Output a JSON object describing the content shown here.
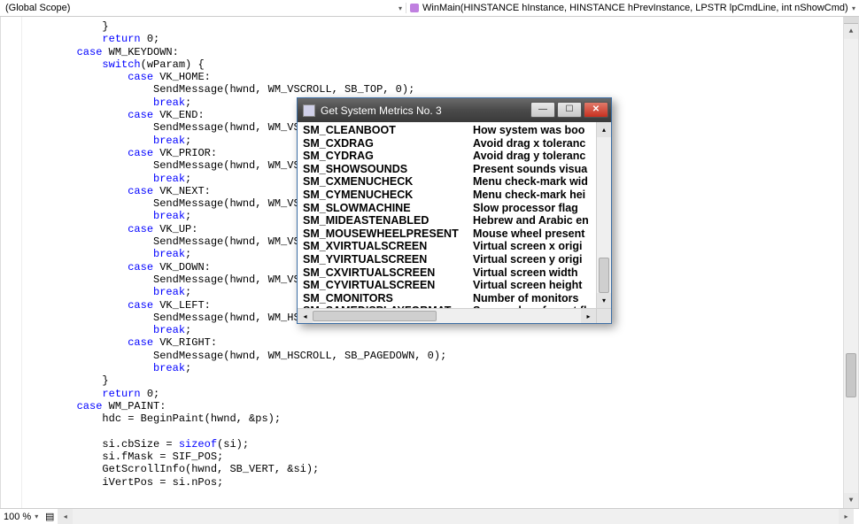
{
  "header": {
    "scope": "(Global Scope)",
    "function": "WinMain(HINSTANCE hInstance, HINSTANCE hPrevInstance, LPSTR lpCmdLine, int nShowCmd)"
  },
  "code": {
    "lines": [
      {
        "indent": 12,
        "tokens": [
          {
            "t": "}",
            "c": ""
          }
        ]
      },
      {
        "indent": 12,
        "tokens": [
          {
            "t": "return",
            "c": "kw"
          },
          {
            "t": " 0;",
            "c": ""
          }
        ]
      },
      {
        "indent": 8,
        "tokens": [
          {
            "t": "case",
            "c": "kw"
          },
          {
            "t": " WM_KEYDOWN:",
            "c": ""
          }
        ]
      },
      {
        "indent": 12,
        "tokens": [
          {
            "t": "switch",
            "c": "kw"
          },
          {
            "t": "(wParam) {",
            "c": ""
          }
        ]
      },
      {
        "indent": 16,
        "tokens": [
          {
            "t": "case",
            "c": "kw"
          },
          {
            "t": " VK_HOME:",
            "c": ""
          }
        ]
      },
      {
        "indent": 20,
        "tokens": [
          {
            "t": "SendMessage(hwnd, WM_VSCROLL, SB_TOP, 0);",
            "c": ""
          }
        ]
      },
      {
        "indent": 20,
        "tokens": [
          {
            "t": "break",
            "c": "kw"
          },
          {
            "t": ";",
            "c": ""
          }
        ]
      },
      {
        "indent": 16,
        "tokens": [
          {
            "t": "case",
            "c": "kw"
          },
          {
            "t": " VK_END:",
            "c": ""
          }
        ]
      },
      {
        "indent": 20,
        "tokens": [
          {
            "t": "SendMessage(hwnd, WM_VSCROLL",
            "c": ""
          }
        ]
      },
      {
        "indent": 20,
        "tokens": [
          {
            "t": "break",
            "c": "kw"
          },
          {
            "t": ";",
            "c": ""
          }
        ]
      },
      {
        "indent": 16,
        "tokens": [
          {
            "t": "case",
            "c": "kw"
          },
          {
            "t": " VK_PRIOR:",
            "c": ""
          }
        ]
      },
      {
        "indent": 20,
        "tokens": [
          {
            "t": "SendMessage(hwnd, WM_VSCROLL",
            "c": ""
          }
        ]
      },
      {
        "indent": 20,
        "tokens": [
          {
            "t": "break",
            "c": "kw"
          },
          {
            "t": ";",
            "c": ""
          }
        ]
      },
      {
        "indent": 16,
        "tokens": [
          {
            "t": "case",
            "c": "kw"
          },
          {
            "t": " VK_NEXT:",
            "c": ""
          }
        ]
      },
      {
        "indent": 20,
        "tokens": [
          {
            "t": "SendMessage(hwnd, WM_VSCROLL",
            "c": ""
          }
        ]
      },
      {
        "indent": 20,
        "tokens": [
          {
            "t": "break",
            "c": "kw"
          },
          {
            "t": ";",
            "c": ""
          }
        ]
      },
      {
        "indent": 16,
        "tokens": [
          {
            "t": "case",
            "c": "kw"
          },
          {
            "t": " VK_UP:",
            "c": ""
          }
        ]
      },
      {
        "indent": 20,
        "tokens": [
          {
            "t": "SendMessage(hwnd, WM_VSCROLL",
            "c": ""
          }
        ]
      },
      {
        "indent": 20,
        "tokens": [
          {
            "t": "break",
            "c": "kw"
          },
          {
            "t": ";",
            "c": ""
          }
        ]
      },
      {
        "indent": 16,
        "tokens": [
          {
            "t": "case",
            "c": "kw"
          },
          {
            "t": " VK_DOWN:",
            "c": ""
          }
        ]
      },
      {
        "indent": 20,
        "tokens": [
          {
            "t": "SendMessage(hwnd, WM_VSCROLL",
            "c": ""
          }
        ]
      },
      {
        "indent": 20,
        "tokens": [
          {
            "t": "break",
            "c": "kw"
          },
          {
            "t": ";",
            "c": ""
          }
        ]
      },
      {
        "indent": 16,
        "tokens": [
          {
            "t": "case",
            "c": "kw"
          },
          {
            "t": " VK_LEFT:",
            "c": ""
          }
        ]
      },
      {
        "indent": 20,
        "tokens": [
          {
            "t": "SendMessage(hwnd, WM_HSCROLL",
            "c": ""
          }
        ]
      },
      {
        "indent": 20,
        "tokens": [
          {
            "t": "break",
            "c": "kw"
          },
          {
            "t": ";",
            "c": ""
          }
        ]
      },
      {
        "indent": 16,
        "tokens": [
          {
            "t": "case",
            "c": "kw"
          },
          {
            "t": " VK_RIGHT:",
            "c": ""
          }
        ]
      },
      {
        "indent": 20,
        "tokens": [
          {
            "t": "SendMessage(hwnd, WM_HSCROLL, SB_PAGEDOWN, 0);",
            "c": ""
          }
        ]
      },
      {
        "indent": 20,
        "tokens": [
          {
            "t": "break",
            "c": "kw"
          },
          {
            "t": ";",
            "c": ""
          }
        ]
      },
      {
        "indent": 12,
        "tokens": [
          {
            "t": "}",
            "c": ""
          }
        ]
      },
      {
        "indent": 12,
        "tokens": [
          {
            "t": "return",
            "c": "kw"
          },
          {
            "t": " 0;",
            "c": ""
          }
        ]
      },
      {
        "indent": 8,
        "tokens": [
          {
            "t": "case",
            "c": "kw"
          },
          {
            "t": " WM_PAINT:",
            "c": ""
          }
        ]
      },
      {
        "indent": 12,
        "tokens": [
          {
            "t": "hdc = BeginPaint(hwnd, &ps);",
            "c": ""
          }
        ]
      },
      {
        "indent": 12,
        "tokens": [
          {
            "t": "",
            "c": ""
          }
        ]
      },
      {
        "indent": 12,
        "tokens": [
          {
            "t": "si.cbSize = ",
            "c": ""
          },
          {
            "t": "sizeof",
            "c": "kw"
          },
          {
            "t": "(si);",
            "c": ""
          }
        ]
      },
      {
        "indent": 12,
        "tokens": [
          {
            "t": "si.fMask = SIF_POS;",
            "c": ""
          }
        ]
      },
      {
        "indent": 12,
        "tokens": [
          {
            "t": "GetScrollInfo(hwnd, SB_VERT, &si);",
            "c": ""
          }
        ]
      },
      {
        "indent": 12,
        "tokens": [
          {
            "t": "iVertPos = si.nPos;",
            "c": ""
          }
        ]
      }
    ]
  },
  "popup": {
    "title": "Get System Metrics No. 3",
    "rows": [
      {
        "k": "SM_CLEANBOOT",
        "v": "How system was boo"
      },
      {
        "k": "SM_CXDRAG",
        "v": "Avoid drag x toleranc"
      },
      {
        "k": "SM_CYDRAG",
        "v": "Avoid drag y toleranc"
      },
      {
        "k": "SM_SHOWSOUNDS",
        "v": "Present sounds visua"
      },
      {
        "k": "SM_CXMENUCHECK",
        "v": "Menu check-mark wid"
      },
      {
        "k": "SM_CYMENUCHECK",
        "v": "Menu check-mark hei"
      },
      {
        "k": "SM_SLOWMACHINE",
        "v": "Slow processor flag"
      },
      {
        "k": "SM_MIDEASTENABLED",
        "v": "Hebrew and Arabic en"
      },
      {
        "k": "SM_MOUSEWHEELPRESENT",
        "v": "Mouse wheel present"
      },
      {
        "k": "SM_XVIRTUALSCREEN",
        "v": "Virtual screen x origi"
      },
      {
        "k": "SM_YVIRTUALSCREEN",
        "v": "Virtual screen y origi"
      },
      {
        "k": "SM_CXVIRTUALSCREEN",
        "v": "Virtual screen width"
      },
      {
        "k": "SM_CYVIRTUALSCREEN",
        "v": "Virtual screen height"
      },
      {
        "k": "SM_CMONITORS",
        "v": "Number of monitors"
      },
      {
        "k": "SM_SAMEDISPLAYFORMAT",
        "v": "Same colour format fl"
      }
    ]
  },
  "status": {
    "zoom": "100 %"
  }
}
